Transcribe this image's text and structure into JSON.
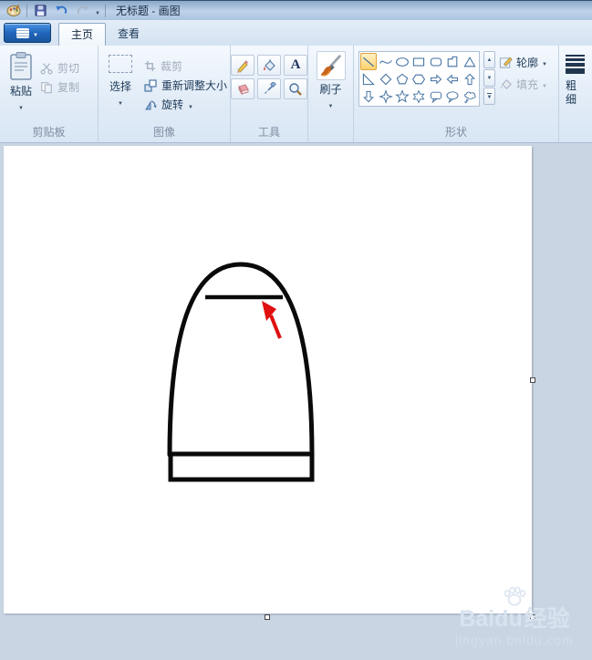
{
  "window": {
    "title": "无标题 - 画图"
  },
  "quick_access": {
    "icons": [
      "paint-app-icon",
      "save-icon",
      "undo-icon",
      "redo-icon",
      "toolbar-dropdown-icon"
    ]
  },
  "tabs": {
    "home": "主页",
    "view": "查看"
  },
  "ribbon": {
    "clipboard": {
      "group_label": "剪贴板",
      "paste": "粘贴",
      "cut": "剪切",
      "copy": "复制"
    },
    "image": {
      "group_label": "图像",
      "select": "选择",
      "crop": "裁剪",
      "resize": "重新调整大小",
      "rotate": "旋转"
    },
    "tools": {
      "group_label": "工具",
      "text_tool_glyph": "A",
      "items": [
        "pencil",
        "fill-bucket",
        "text",
        "eraser",
        "color-picker",
        "magnifier"
      ]
    },
    "brushes": {
      "label": "刷子"
    },
    "shapes": {
      "group_label": "形状",
      "outline": "轮廓",
      "fill": "填充",
      "selected_shape": "line",
      "items": [
        "line",
        "curve",
        "ellipse",
        "rectangle",
        "rounded-rectangle",
        "polygon",
        "triangle",
        "right-triangle",
        "diamond",
        "pentagon",
        "hexagon",
        "right-arrow",
        "left-arrow",
        "up-arrow",
        "down-arrow",
        "four-point-star",
        "five-point-star",
        "six-point-star",
        "rounded-callout",
        "oval-callout",
        "cloud-callout"
      ]
    },
    "size": {
      "label": "粗细"
    }
  },
  "canvas": {
    "description": "black bell/paraboloid outline with horizontal collar line, base rectangle, and red annotation arrow pointing at collar line"
  },
  "watermark": {
    "brand": "Baidu",
    "badge": "经验",
    "url": "jingyan.baidu.com"
  },
  "colors": {
    "selection_highlight": "#fbcf68",
    "annotation_arrow": "#e01010",
    "drawing_stroke": "#000000",
    "shape_icon_stroke": "#3f6fa0"
  }
}
